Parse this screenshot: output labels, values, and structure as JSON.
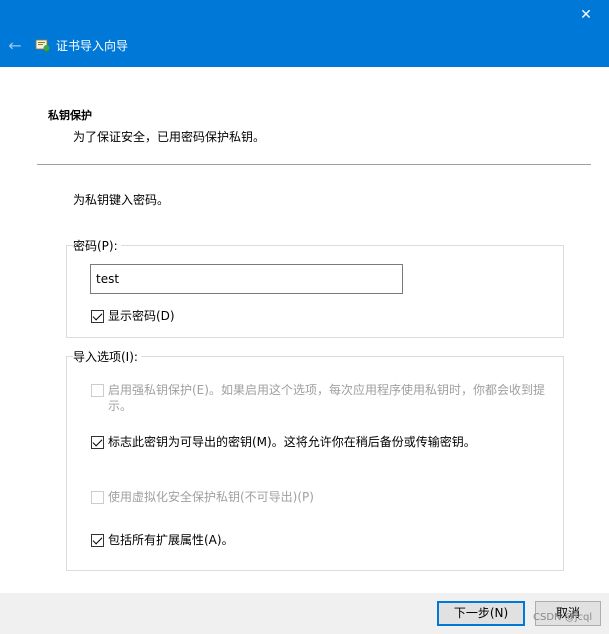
{
  "window": {
    "close_glyph": "✕",
    "back_glyph": "←",
    "title": "证书导入向导"
  },
  "section": {
    "title": "私钥保护",
    "subtitle": "为了保证安全，已用密码保护私钥。"
  },
  "instruction": "为私钥键入密码。",
  "password_group": {
    "label": "密码(P):",
    "value": "test",
    "show_password_label": "显示密码(D)",
    "show_password_checked": true
  },
  "import_options": {
    "label": "导入选项(I):",
    "items": [
      {
        "label_line1": "启用强私钥保护(E)。如果启用这个选项，每次应用程序使用私钥时，你都会收到提",
        "label_line2": "示。",
        "checked": false,
        "enabled": false
      },
      {
        "label": "标志此密钥为可导出的密钥(M)。这将允许你在稍后备份或传输密钥。",
        "checked": true,
        "enabled": true
      },
      {
        "label": "使用虚拟化安全保护私钥(不可导出)(P)",
        "checked": false,
        "enabled": false
      },
      {
        "label": "包括所有扩展属性(A)。",
        "checked": true,
        "enabled": true
      }
    ]
  },
  "footer": {
    "next_label": "下一步(N)",
    "cancel_label": "取消",
    "watermark": "CSDN @jcql"
  },
  "colors": {
    "titlebar": "#0078d7",
    "footer": "#f0f0f0",
    "disabled_text": "#a0a0a0"
  }
}
